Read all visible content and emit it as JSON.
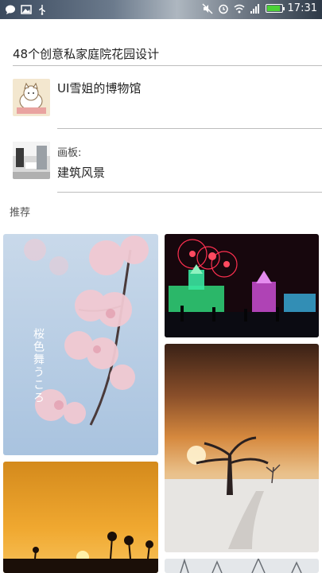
{
  "status_bar": {
    "left_icons": [
      "chat-icon",
      "image-icon",
      "usb-icon"
    ],
    "right_icons": [
      "mute-icon",
      "alarm-icon",
      "wifi-icon",
      "signal-icon",
      "battery-icon"
    ],
    "time": "17:31",
    "battery_color": "#4cd137"
  },
  "article": {
    "title": "48个创意私家庭院花园设计"
  },
  "author": {
    "name": "UI雪姐的博物馆"
  },
  "board": {
    "prefix": "画板:",
    "name": "建筑风景"
  },
  "recommend": {
    "label": "推荐"
  },
  "cards": [
    {
      "subject": "cherry-blossom",
      "calligraphy": "桜色舞うころ"
    },
    {
      "subject": "fireworks-ice-castle"
    },
    {
      "subject": "winter-tree-sunset"
    },
    {
      "subject": "sunset-palms"
    },
    {
      "subject": "snowy-trees"
    }
  ]
}
